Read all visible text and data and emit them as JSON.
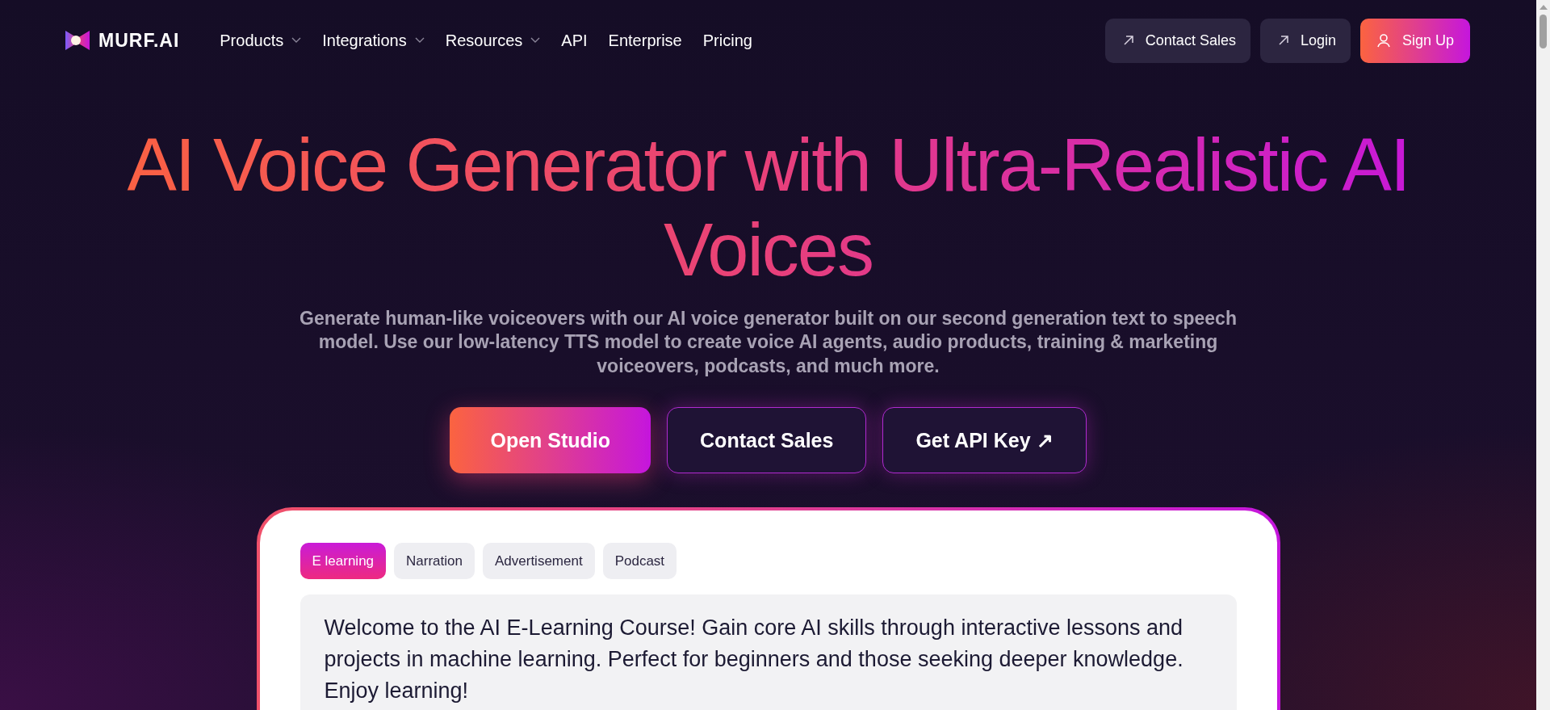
{
  "logo": {
    "text": "MURF.AI"
  },
  "nav": [
    {
      "label": "Products",
      "dropdown": true
    },
    {
      "label": "Integrations",
      "dropdown": true
    },
    {
      "label": "Resources",
      "dropdown": true
    },
    {
      "label": "API",
      "dropdown": false
    },
    {
      "label": "Enterprise",
      "dropdown": false
    },
    {
      "label": "Pricing",
      "dropdown": false
    }
  ],
  "header_buttons": [
    {
      "label": "Contact Sales",
      "kind": "secondary"
    },
    {
      "label": "Login",
      "kind": "secondary"
    },
    {
      "label": "Sign Up",
      "kind": "primary"
    }
  ],
  "hero": {
    "title": "AI Voice Generator with Ultra-Realistic AI Voices",
    "subtitle": "Generate human-like voiceovers with our AI voice generator built on our second generation text to speech model. Use our low-latency TTS model to create voice AI agents, audio products, training & marketing voiceovers, podcasts, and much more.",
    "buttons": [
      {
        "label": "Open Studio",
        "kind": "primary"
      },
      {
        "label": "Contact Sales",
        "kind": "outline"
      },
      {
        "label": "Get API Key ↗",
        "kind": "outline"
      }
    ]
  },
  "demo": {
    "tabs": [
      {
        "label": "E learning",
        "selected": true
      },
      {
        "label": "Narration",
        "selected": false
      },
      {
        "label": "Advertisement",
        "selected": false
      },
      {
        "label": "Podcast",
        "selected": false
      }
    ],
    "text": "Welcome to the AI E-Learning Course! Gain core AI skills through interactive lessons and projects in machine learning. Perfect for beginners and those seeking deeper knowledge. Enjoy learning!"
  }
}
